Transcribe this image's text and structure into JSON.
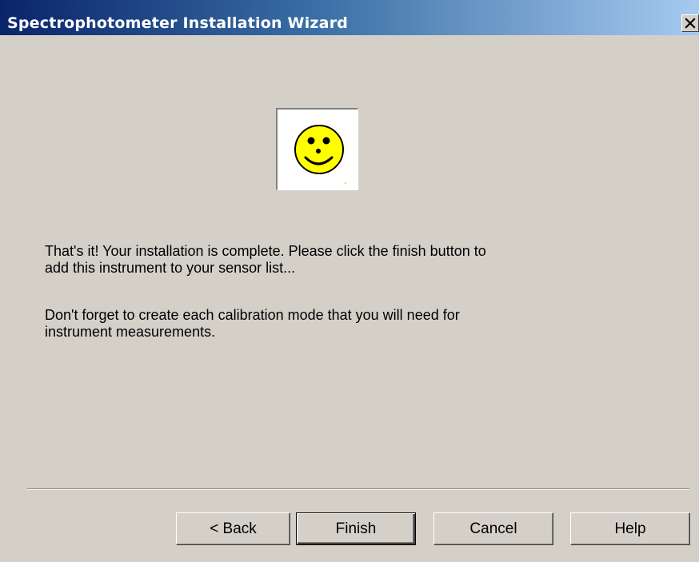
{
  "window": {
    "title": "Spectrophotometer Installation Wizard"
  },
  "titlebar": {
    "close_icon": "close-icon",
    "close_glyph": "✕"
  },
  "illustration": {
    "icon": "smiley-face-icon",
    "face_color": "#ffff00"
  },
  "content": {
    "paragraph1": [
      "That's it!  Your installation is complete.  Please click the finish button to",
      "add this instrument to your sensor list..."
    ],
    "paragraph2": [
      "Don't forget to create each calibration mode that you will need for",
      "instrument measurements."
    ]
  },
  "buttons": {
    "back": "< Back",
    "finish": "Finish",
    "cancel": "Cancel",
    "help": "Help"
  },
  "colors": {
    "titlebar_start": "#0a246a",
    "titlebar_end": "#a6caf0",
    "dialog_background": "#d4d0c8"
  }
}
